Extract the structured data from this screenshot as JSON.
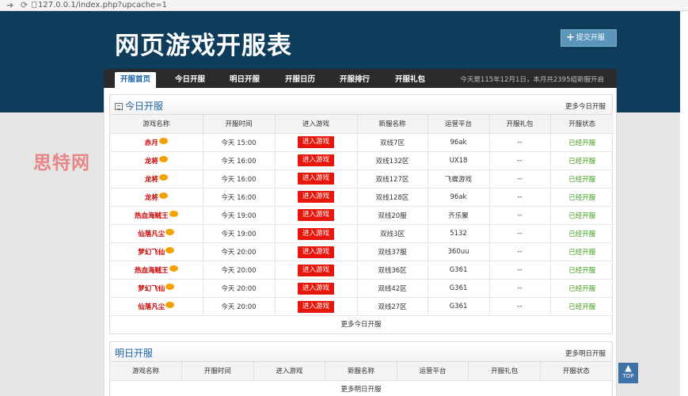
{
  "browser": {
    "url": "127.0.0.1/index.php?upcache=1"
  },
  "header": {
    "title": "网页游戏开服表",
    "submit_label": "提交开服"
  },
  "nav": {
    "tabs": [
      {
        "label": "开服首页",
        "active": true
      },
      {
        "label": "今日开服",
        "active": false
      },
      {
        "label": "明日开服",
        "active": false
      },
      {
        "label": "开服日历",
        "active": false
      },
      {
        "label": "开服排行",
        "active": false
      },
      {
        "label": "开服礼包",
        "active": false
      }
    ],
    "info": "今天是115年12月1日，本月共2395组新服开启"
  },
  "today": {
    "title": "今日开服",
    "more_link": "更多今日开服",
    "columns": [
      "游戏名称",
      "开服时间",
      "进入游戏",
      "新服名称",
      "运营平台",
      "开服礼包",
      "开服状态"
    ],
    "rows": [
      {
        "game": "赤月",
        "time": "今天 15:00",
        "enter": "进入游戏",
        "server": "双线7区",
        "platform": "96ak",
        "gift": "--",
        "status": "已经开服"
      },
      {
        "game": "龙将",
        "time": "今天 16:00",
        "enter": "进入游戏",
        "server": "双线132区",
        "platform": "UX18",
        "gift": "--",
        "status": "已经开服"
      },
      {
        "game": "龙将",
        "time": "今天 16:00",
        "enter": "进入游戏",
        "server": "双线127区",
        "platform": "飞蝶游戏",
        "gift": "--",
        "status": "已经开服"
      },
      {
        "game": "龙将",
        "time": "今天 16:00",
        "enter": "进入游戏",
        "server": "双线128区",
        "platform": "96ak",
        "gift": "--",
        "status": "已经开服"
      },
      {
        "game": "热血海贼王",
        "time": "今天 19:00",
        "enter": "进入游戏",
        "server": "双线20服",
        "platform": "齐乐聚",
        "gift": "--",
        "status": "已经开服"
      },
      {
        "game": "仙落凡尘",
        "time": "今天 19:00",
        "enter": "进入游戏",
        "server": "双线3区",
        "platform": "5132",
        "gift": "--",
        "status": "已经开服"
      },
      {
        "game": "梦幻飞仙",
        "time": "今天 20:00",
        "enter": "进入游戏",
        "server": "双线37服",
        "platform": "360uu",
        "gift": "--",
        "status": "已经开服"
      },
      {
        "game": "热血海贼王",
        "time": "今天 20:00",
        "enter": "进入游戏",
        "server": "双线36区",
        "platform": "G361",
        "gift": "--",
        "status": "已经开服"
      },
      {
        "game": "梦幻飞仙",
        "time": "今天 20:00",
        "enter": "进入游戏",
        "server": "双线42区",
        "platform": "G361",
        "gift": "--",
        "status": "已经开服"
      },
      {
        "game": "仙落凡尘",
        "time": "今天 20:00",
        "enter": "进入游戏",
        "server": "双线27区",
        "platform": "G361",
        "gift": "--",
        "status": "已经开服"
      }
    ],
    "more_bottom": "更多今日开服"
  },
  "tomorrow": {
    "title": "明日开服",
    "more_link": "更多明日开服",
    "columns": [
      "游戏名称",
      "开服时间",
      "进入游戏",
      "新服名称",
      "运营平台",
      "开服礼包",
      "开服状态"
    ],
    "more_bottom": "更多明日开服"
  },
  "watermark": "思特网",
  "back_top": {
    "label": "TOP"
  },
  "colors": {
    "header_bg": "#0e3d5c",
    "nav_bg": "#2b2b2b",
    "enter_button": "#e8170b",
    "status_open": "#3f9e1a",
    "link_blue": "#1a63a8"
  }
}
